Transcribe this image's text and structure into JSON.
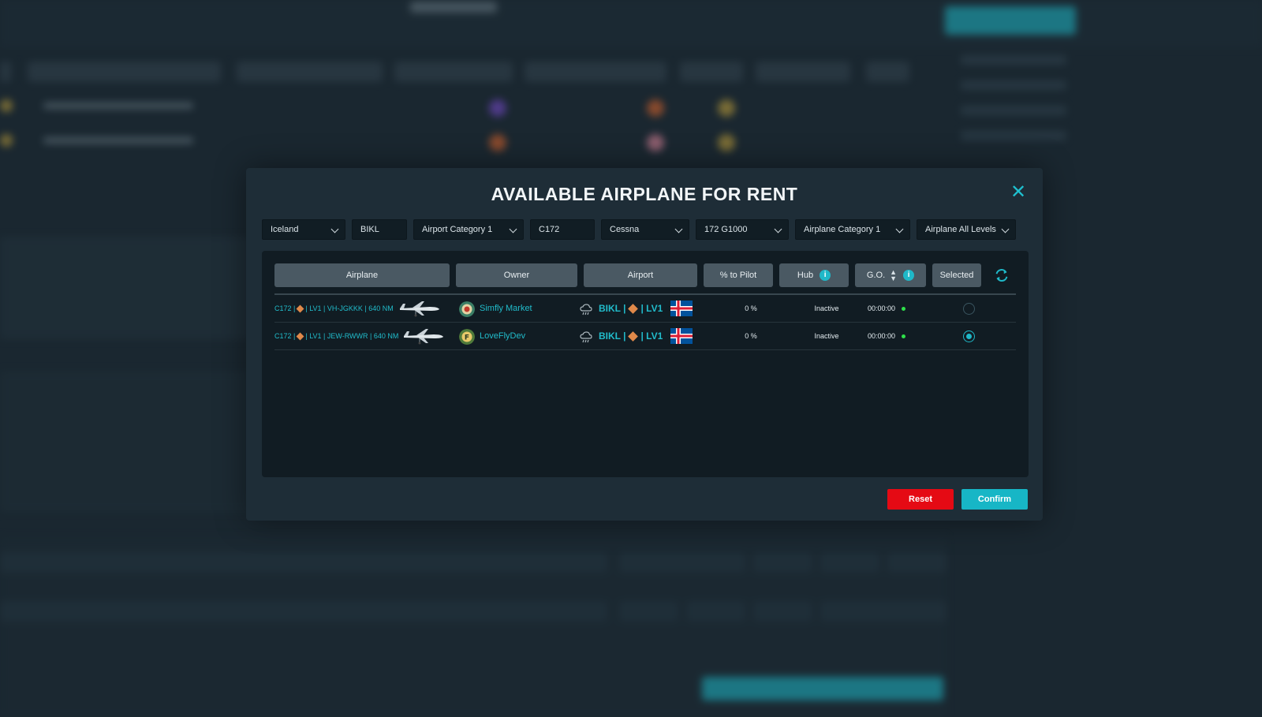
{
  "modal": {
    "title": "AVAILABLE AIRPLANE FOR RENT",
    "close_icon": "close-icon"
  },
  "filters": {
    "country": "Iceland",
    "airport_code": "BIKL",
    "airport_category": "Airport Category 1",
    "airplane_model": "C172",
    "manufacturer": "Cessna",
    "variant": "172 G1000",
    "airplane_category": "Airplane Category 1",
    "airplane_level": "Airplane All Levels"
  },
  "table": {
    "headers": {
      "airplane": "Airplane",
      "owner": "Owner",
      "airport": "Airport",
      "pct_to_pilot": "% to Pilot",
      "hub": "Hub",
      "go": "G.O.",
      "selected": "Selected"
    },
    "rows": [
      {
        "airplane_model": "C172 |",
        "airplane_details": "| LV1 | VH-JGKKK | 640 NM",
        "owner": "Simfly Market",
        "airport_code": "BIKL |",
        "airport_level": "| LV1",
        "pct_to_pilot": "0 %",
        "hub_status": "Inactive",
        "go_time": "00:00:00",
        "selected": false
      },
      {
        "airplane_model": "C172 |",
        "airplane_details": "| LV1 | JEW-RWWR | 640 NM",
        "owner": "LoveFlyDev",
        "airport_code": "BIKL |",
        "airport_level": "| LV1",
        "pct_to_pilot": "0 %",
        "hub_status": "Inactive",
        "go_time": "00:00:00",
        "selected": true
      }
    ]
  },
  "buttons": {
    "reset": "Reset",
    "confirm": "Confirm"
  },
  "colors": {
    "accent": "#17b6c6",
    "danger": "#e50a14",
    "status_online": "#2ee04a",
    "level_diamond": "#e0894a"
  }
}
